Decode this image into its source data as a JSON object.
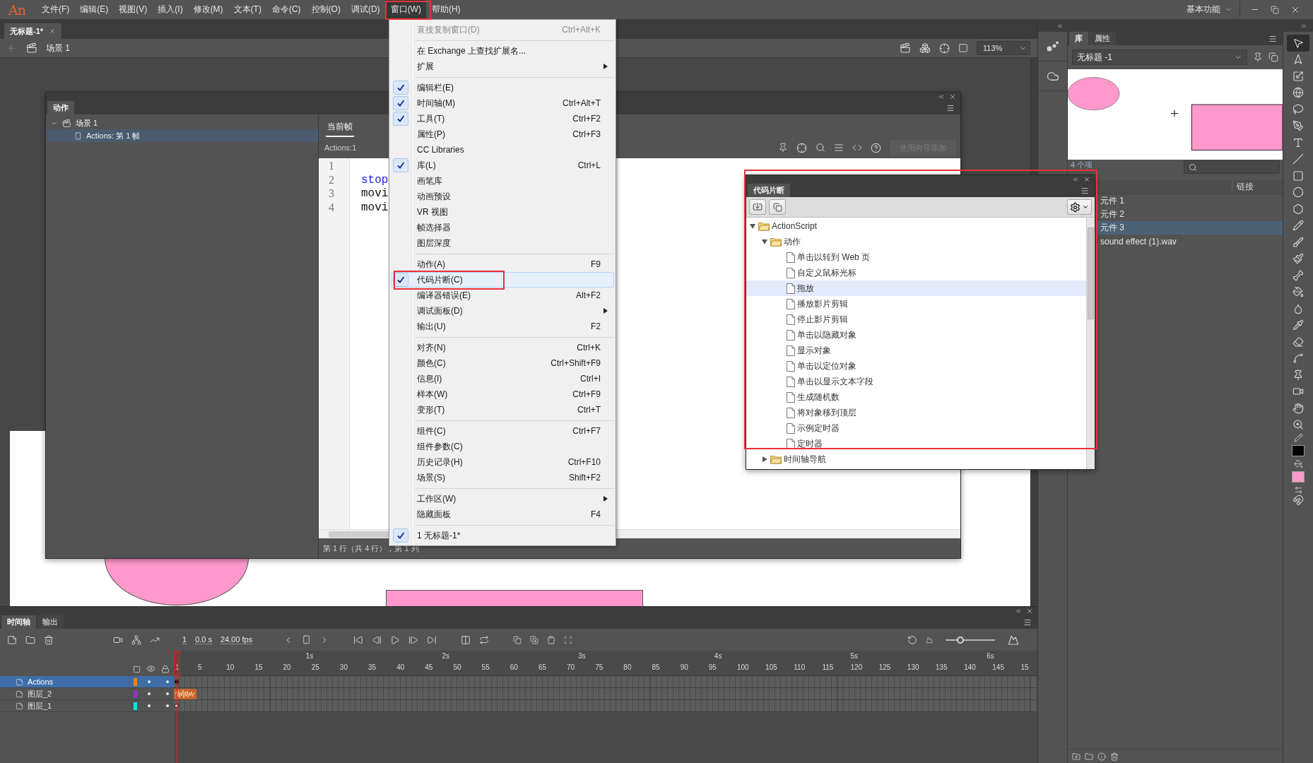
{
  "app": {
    "logo": "An",
    "menus": [
      {
        "label": "文件(F)",
        "selected": false
      },
      {
        "label": "编辑(E)",
        "selected": false
      },
      {
        "label": "视图(V)",
        "selected": false
      },
      {
        "label": "插入(I)",
        "selected": false
      },
      {
        "label": "修改(M)",
        "selected": false
      },
      {
        "label": "文本(T)",
        "selected": false
      },
      {
        "label": "命令(C)",
        "selected": false
      },
      {
        "label": "控制(O)",
        "selected": false
      },
      {
        "label": "调试(D)",
        "selected": false
      },
      {
        "label": "窗口(W)",
        "selected": true
      },
      {
        "label": "帮助(H)",
        "selected": false
      }
    ],
    "workspace": "基本功能"
  },
  "document_tabs": [
    {
      "label": "无标题-1*",
      "selected": true
    }
  ],
  "edit_bar": {
    "scene": "场景 1",
    "zoom": "113%"
  },
  "actions_panel": {
    "title": "动作",
    "tree": [
      {
        "label": "场景 1",
        "kind": "scene",
        "expanded": true,
        "selected": false,
        "children": [
          {
            "label": "Actions: 第 1 帧",
            "kind": "frame",
            "selected": true
          }
        ]
      }
    ],
    "tabs": [
      {
        "label": "当前帧",
        "selected": true
      }
    ],
    "target": "Actions:1",
    "wizard_button": {
      "label": "使用向导添加",
      "disabled": true
    },
    "lines": [
      {
        "number": "1"
      },
      {
        "number": "2",
        "code": "stop",
        "kind": "keyword"
      },
      {
        "number": "3",
        "code": "movi",
        "kind": "plain"
      },
      {
        "number": "4",
        "code": "movi",
        "kind": "plain"
      }
    ],
    "status": "第 1 行（共 4 行），第 1 列"
  },
  "window_menu": {
    "groups": [
      [
        {
          "label": "直接复制窗口(D)",
          "shortcut": "Ctrl+Alt+K",
          "checked": false,
          "selected": false,
          "disabled": true,
          "submenu": false
        }
      ],
      [
        {
          "label": "在 Exchange 上查找扩展名...",
          "checked": false,
          "selected": false,
          "disabled": false,
          "submenu": false
        },
        {
          "label": "扩展",
          "checked": false,
          "selected": false,
          "disabled": false,
          "submenu": true
        }
      ],
      [
        {
          "label": "编辑栏(E)",
          "checked": true,
          "selected": false,
          "disabled": false,
          "submenu": false
        },
        {
          "label": "时间轴(M)",
          "shortcut": "Ctrl+Alt+T",
          "checked": true,
          "selected": false,
          "disabled": false,
          "submenu": false
        },
        {
          "label": "工具(T)",
          "shortcut": "Ctrl+F2",
          "checked": true,
          "selected": false,
          "disabled": false,
          "submenu": false
        },
        {
          "label": "属性(P)",
          "shortcut": "Ctrl+F3",
          "checked": false,
          "selected": false,
          "disabled": false,
          "submenu": false
        },
        {
          "label": "CC Libraries",
          "checked": false,
          "selected": false,
          "disabled": false,
          "submenu": false
        },
        {
          "label": "库(L)",
          "shortcut": "Ctrl+L",
          "checked": true,
          "selected": false,
          "disabled": false,
          "submenu": false
        },
        {
          "label": "画笔库",
          "checked": false,
          "selected": false,
          "disabled": false,
          "submenu": false
        },
        {
          "label": "动画预设",
          "checked": false,
          "selected": false,
          "disabled": false,
          "submenu": false
        },
        {
          "label": "VR 视图",
          "checked": false,
          "selected": false,
          "disabled": false,
          "submenu": false
        },
        {
          "label": "帧选择器",
          "checked": false,
          "selected": false,
          "disabled": false,
          "submenu": false
        },
        {
          "label": "图层深度",
          "checked": false,
          "selected": false,
          "disabled": false,
          "submenu": false
        }
      ],
      [
        {
          "label": "动作(A)",
          "shortcut": "F9",
          "checked": false,
          "selected": false,
          "disabled": false,
          "submenu": false
        },
        {
          "label": "代码片断(C)",
          "checked": true,
          "selected": true,
          "disabled": false,
          "submenu": false
        },
        {
          "label": "编译器错误(E)",
          "shortcut": "Alt+F2",
          "checked": false,
          "selected": false,
          "disabled": false,
          "submenu": false
        },
        {
          "label": "调试面板(D)",
          "checked": false,
          "selected": false,
          "disabled": false,
          "submenu": true
        },
        {
          "label": "输出(U)",
          "shortcut": "F2",
          "checked": false,
          "selected": false,
          "disabled": false,
          "submenu": false
        }
      ],
      [
        {
          "label": "对齐(N)",
          "shortcut": "Ctrl+K",
          "checked": false,
          "selected": false,
          "disabled": false,
          "submenu": false
        },
        {
          "label": "颜色(C)",
          "shortcut": "Ctrl+Shift+F9",
          "checked": false,
          "selected": false,
          "disabled": false,
          "submenu": false
        },
        {
          "label": "信息(I)",
          "shortcut": "Ctrl+I",
          "checked": false,
          "selected": false,
          "disabled": false,
          "submenu": false
        },
        {
          "label": "样本(W)",
          "shortcut": "Ctrl+F9",
          "checked": false,
          "selected": false,
          "disabled": false,
          "submenu": false
        },
        {
          "label": "变形(T)",
          "shortcut": "Ctrl+T",
          "checked": false,
          "selected": false,
          "disabled": false,
          "submenu": false
        }
      ],
      [
        {
          "label": "组件(C)",
          "shortcut": "Ctrl+F7",
          "checked": false,
          "selected": false,
          "disabled": false,
          "submenu": false
        },
        {
          "label": "组件参数(C)",
          "checked": false,
          "selected": false,
          "disabled": false,
          "submenu": false
        },
        {
          "label": "历史记录(H)",
          "shortcut": "Ctrl+F10",
          "checked": false,
          "selected": false,
          "disabled": false,
          "submenu": false
        },
        {
          "label": "场景(S)",
          "shortcut": "Shift+F2",
          "checked": false,
          "selected": false,
          "disabled": false,
          "submenu": false
        }
      ],
      [
        {
          "label": "工作区(W)",
          "checked": false,
          "selected": false,
          "disabled": false,
          "submenu": true
        },
        {
          "label": "隐藏面板",
          "shortcut": "F4",
          "checked": false,
          "selected": false,
          "disabled": false,
          "submenu": false
        }
      ],
      [
        {
          "label": "1 无标题-1*",
          "checked": true,
          "selected": false,
          "disabled": false,
          "submenu": false
        }
      ]
    ]
  },
  "code_snippets": {
    "title": "代码片断",
    "tree": [
      {
        "label": "ActionScript",
        "kind": "folder",
        "expanded": true,
        "selected": false,
        "children": [
          {
            "label": "动作",
            "kind": "folder",
            "expanded": true,
            "selected": false,
            "children": [
              {
                "label": "单击以转到 Web 页",
                "kind": "file",
                "selected": false
              },
              {
                "label": "自定义鼠标光标",
                "kind": "file",
                "selected": false
              },
              {
                "label": "拖放",
                "kind": "file",
                "selected": true
              },
              {
                "label": "播放影片剪辑",
                "kind": "file",
                "selected": false
              },
              {
                "label": "停止影片剪辑",
                "kind": "file",
                "selected": false
              },
              {
                "label": "单击以隐藏对象",
                "kind": "file",
                "selected": false
              },
              {
                "label": "显示对象",
                "kind": "file",
                "selected": false
              },
              {
                "label": "单击以定位对象",
                "kind": "file",
                "selected": false
              },
              {
                "label": "单击以显示文本字段",
                "kind": "file",
                "selected": false
              },
              {
                "label": "生成随机数",
                "kind": "file",
                "selected": false
              },
              {
                "label": "将对象移到顶层",
                "kind": "file",
                "selected": false
              },
              {
                "label": "示例定时器",
                "kind": "file",
                "selected": false
              },
              {
                "label": "定时器",
                "kind": "file",
                "selected": false
              }
            ]
          },
          {
            "label": "时间轴导航",
            "kind": "folder",
            "expanded": false,
            "selected": false
          }
        ]
      }
    ]
  },
  "library": {
    "tabs": [
      {
        "label": "库",
        "selected": true
      },
      {
        "label": "属性",
        "selected": false
      }
    ],
    "document": "无标题 -1",
    "count": "4 个项",
    "columns": [
      "链接"
    ],
    "items": [
      {
        "label": "元件 1",
        "selected": false
      },
      {
        "label": "元件 2",
        "selected": false
      },
      {
        "label": "元件 3",
        "selected": true
      },
      {
        "label": "sound effect (1).wav",
        "selected": false
      }
    ]
  },
  "tools": {
    "items": [
      {
        "selected": true
      },
      {
        "selected": false
      },
      {
        "selected": false
      },
      {
        "selected": false
      },
      {
        "selected": false
      },
      {
        "selected": false
      },
      {
        "selected": false
      },
      {
        "selected": false
      },
      {
        "selected": false
      },
      {
        "selected": false
      },
      {
        "selected": false
      },
      {
        "selected": false
      },
      {
        "selected": false
      },
      {
        "selected": false
      },
      {
        "selected": false
      },
      {
        "selected": false
      },
      {
        "selected": false
      },
      {
        "selected": false
      },
      {
        "selected": false
      },
      {
        "selected": false
      },
      {
        "selected": false
      },
      {
        "selected": false
      },
      {
        "selected": false
      },
      {
        "selected": false
      }
    ],
    "colors": [
      {
        "kind": "stroke",
        "color": "#000000"
      },
      {
        "kind": "fill",
        "color": "#ff99cc"
      }
    ]
  },
  "timeline": {
    "tabs": [
      {
        "label": "时间轴",
        "selected": true
      },
      {
        "label": "输出",
        "selected": false
      }
    ],
    "frame": "1",
    "time": "0.0 s",
    "fps": "24.00 fps",
    "zoom_slider": {
      "level": 0.3
    },
    "seconds": [
      "1s",
      "2s",
      "3s",
      "4s",
      "5s",
      "6s"
    ],
    "frames": [
      "1",
      "5",
      "10",
      "15",
      "20",
      "25",
      "30",
      "35",
      "40",
      "45",
      "50",
      "55",
      "60",
      "65",
      "70",
      "75",
      "80",
      "85",
      "90",
      "95",
      "100",
      "105",
      "110",
      "115",
      "120",
      "125",
      "130",
      "135",
      "140",
      "145",
      "15"
    ],
    "layers": [
      {
        "name": "Actions",
        "kind": "script",
        "color": "#f5820b",
        "selected": true
      },
      {
        "name": "图层_2",
        "kind": "sound",
        "color": "#9b2fc9",
        "selected": false
      },
      {
        "name": "图层_1",
        "kind": "shape",
        "color": "#00e5e5",
        "selected": false
      }
    ]
  }
}
